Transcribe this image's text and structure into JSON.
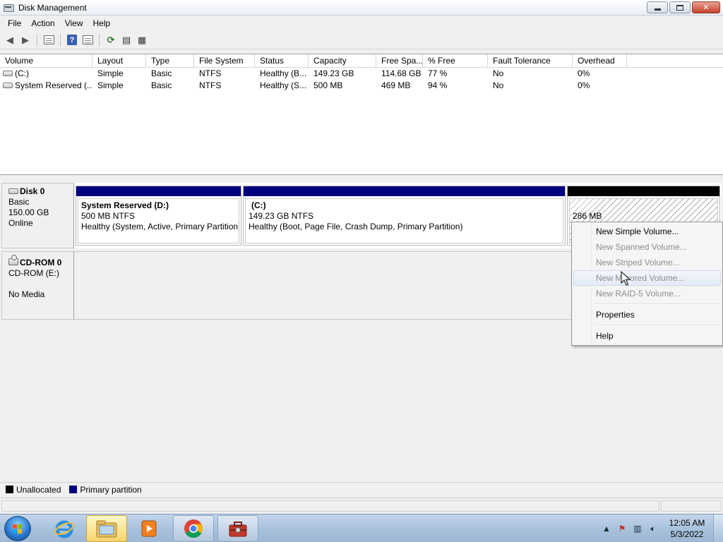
{
  "window": {
    "title": "Disk Management"
  },
  "menu": [
    "File",
    "Action",
    "View",
    "Help"
  ],
  "volume_table": {
    "columns": [
      "Volume",
      "Layout",
      "Type",
      "File System",
      "Status",
      "Capacity",
      "Free Spa...",
      "% Free",
      "Fault Tolerance",
      "Overhead"
    ],
    "rows": [
      [
        "(C:)",
        "Simple",
        "Basic",
        "NTFS",
        "Healthy (B...",
        "149.23 GB",
        "114.68 GB",
        "77 %",
        "No",
        "0%"
      ],
      [
        "System Reserved (...",
        "Simple",
        "Basic",
        "NTFS",
        "Healthy (S...",
        "500 MB",
        "469 MB",
        "94 %",
        "No",
        "0%"
      ]
    ]
  },
  "disk0": {
    "name": "Disk 0",
    "type": "Basic",
    "size": "150.00 GB",
    "status": "Online",
    "partitions": [
      {
        "name": "System Reserved  (D:)",
        "size": "500 MB NTFS",
        "status": "Healthy (System, Active, Primary Partition)"
      },
      {
        "name": "(C:)",
        "size": "149.23 GB NTFS",
        "status": "Healthy (Boot, Page File, Crash Dump, Primary Partition)"
      },
      {
        "size": "286 MB"
      }
    ]
  },
  "cdrom0": {
    "name": "CD-ROM 0",
    "drive": "CD-ROM (E:)",
    "status": "No Media"
  },
  "legend": [
    {
      "label": "Unallocated",
      "color": "#000000"
    },
    {
      "label": "Primary partition",
      "color": "#00007f"
    }
  ],
  "context_menu": [
    {
      "label": "New Simple Volume...",
      "enabled": true
    },
    {
      "label": "New Spanned Volume...",
      "enabled": false
    },
    {
      "label": "New Striped Volume...",
      "enabled": false
    },
    {
      "label": "New Mirrored Volume...",
      "enabled": false,
      "hovered": true
    },
    {
      "label": "New RAID-5 Volume...",
      "enabled": false
    },
    {
      "label": "Properties",
      "enabled": true
    },
    {
      "label": "Help",
      "enabled": true
    }
  ],
  "taskbar": {
    "apps": [
      "internet-explorer-icon",
      "windows-explorer-icon",
      "media-player-icon",
      "chrome-icon",
      "computer-management-icon"
    ],
    "clock_time": "12:05 AM",
    "clock_date": "5/3/2022"
  },
  "colors": {
    "primary_partition": "#00007f",
    "unallocated": "#000000",
    "taskbar": "#a9c2dd"
  }
}
